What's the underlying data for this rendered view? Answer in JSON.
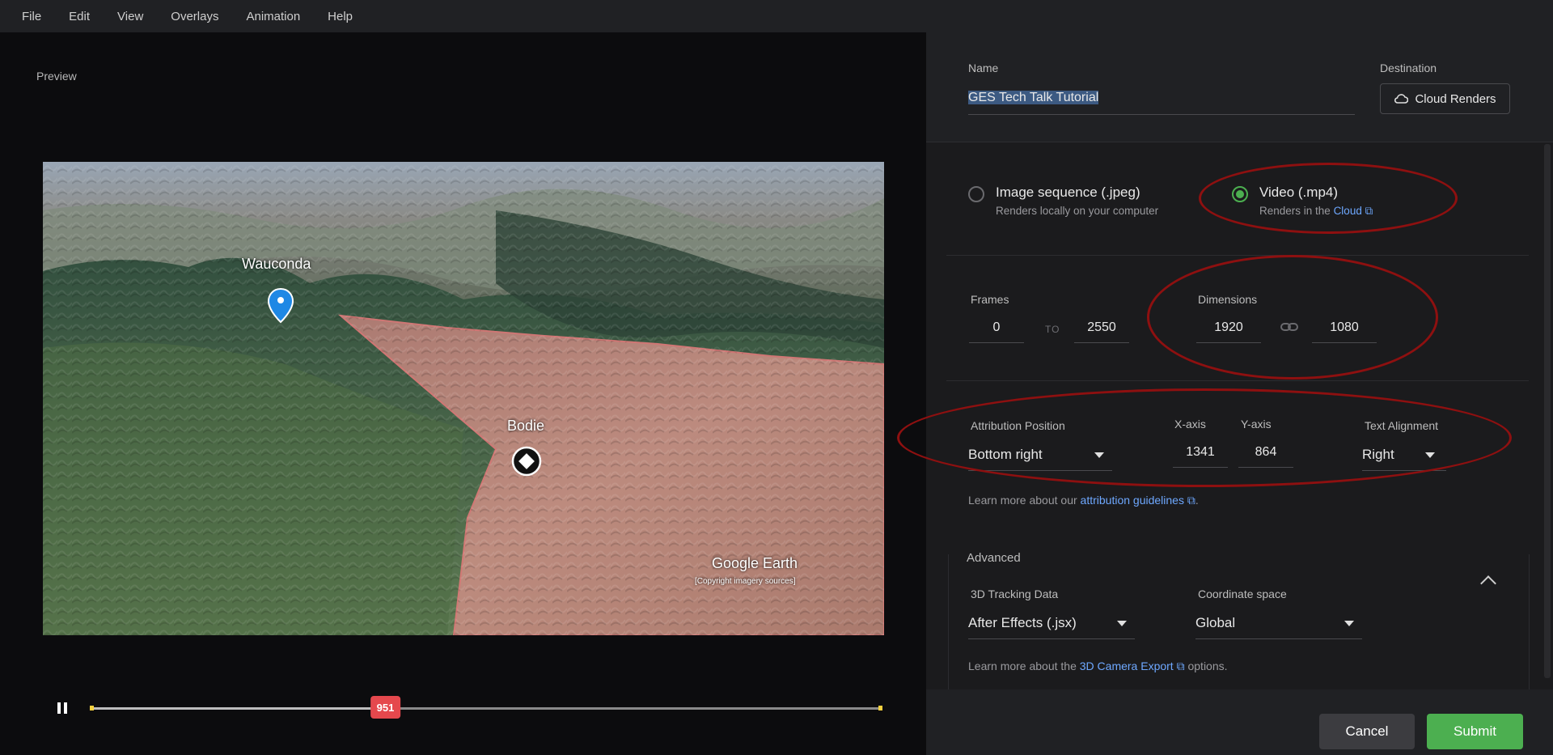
{
  "menu": [
    "File",
    "Edit",
    "View",
    "Overlays",
    "Animation",
    "Help"
  ],
  "preview": {
    "label": "Preview",
    "labels": {
      "wauconda": "Wauconda",
      "bodie": "Bodie"
    },
    "watermark": {
      "brand": "Google Earth",
      "credit": "[Copyright imagery sources]"
    },
    "timeline": {
      "current_frame": "951",
      "progress_fraction": 0.373
    }
  },
  "dialog": {
    "name_label": "Name",
    "name_value": "GES Tech Talk Tutorial",
    "destination_label": "Destination",
    "destination_value": "Cloud Renders",
    "output": {
      "image_title": "Image sequence (.jpeg)",
      "image_sub": "Renders locally on your computer",
      "video_title": "Video (.mp4)",
      "video_sub_prefix": "Renders in the ",
      "video_sub_link": "Cloud"
    },
    "frames": {
      "label": "Frames",
      "start": "0",
      "to": "TO",
      "end": "2550"
    },
    "dimensions": {
      "label": "Dimensions",
      "width": "1920",
      "height": "1080"
    },
    "attribution": {
      "position_label": "Attribution Position",
      "position_value": "Bottom right",
      "x_label": "X-axis",
      "x_value": "1341",
      "y_label": "Y-axis",
      "y_value": "864",
      "align_label": "Text Alignment",
      "align_value": "Right",
      "note_prefix": "Learn more about our ",
      "note_link": "attribution guidelines",
      "note_suffix": "."
    },
    "advanced": {
      "label": "Advanced",
      "tracking_label": "3D Tracking Data",
      "tracking_value": "After Effects (.jsx)",
      "coord_label": "Coordinate space",
      "coord_value": "Global",
      "note_prefix": "Learn more about the ",
      "note_link": "3D Camera Export",
      "note_suffix": " options."
    },
    "cancel": "Cancel",
    "submit": "Submit"
  },
  "colors": {
    "accent_green": "#4caf50",
    "annotation_ring": "#8e1010",
    "link_blue": "#6ea8ff",
    "playhead_red": "#e5484d"
  }
}
